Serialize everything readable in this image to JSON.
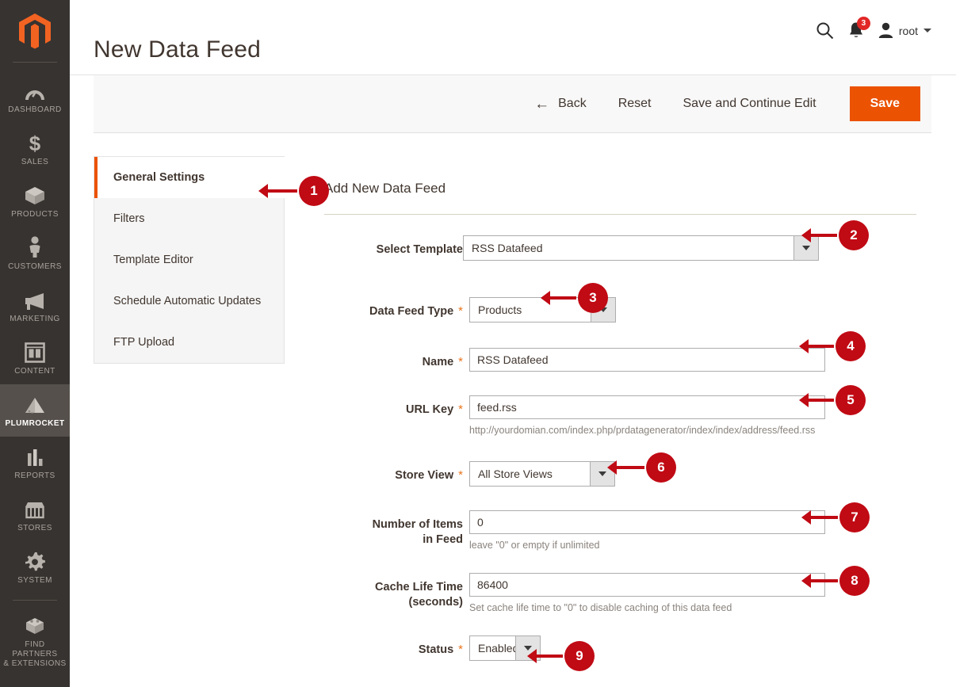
{
  "adminnav": {
    "logo_name": "magento-logo-icon",
    "items": [
      {
        "label": "DASHBOARD",
        "icon": "dashboard-icon",
        "active": false
      },
      {
        "label": "SALES",
        "icon": "dollar-icon",
        "active": false
      },
      {
        "label": "PRODUCTS",
        "icon": "box-icon",
        "active": false
      },
      {
        "label": "CUSTOMERS",
        "icon": "person-icon",
        "active": false
      },
      {
        "label": "MARKETING",
        "icon": "megaphone-icon",
        "active": false
      },
      {
        "label": "CONTENT",
        "icon": "layout-icon",
        "active": false
      },
      {
        "label": "PLUMROCKET",
        "icon": "plumrocket-icon",
        "active": true
      },
      {
        "label": "REPORTS",
        "icon": "bar-chart-icon",
        "active": false
      },
      {
        "label": "STORES",
        "icon": "storefront-icon",
        "active": false
      },
      {
        "label": "SYSTEM",
        "icon": "gear-icon",
        "active": false
      },
      {
        "label": "FIND PARTNERS\n& EXTENSIONS",
        "icon": "extension-box-icon",
        "active": false
      }
    ],
    "find_partners_line1": "FIND PARTNERS",
    "find_partners_line2": "& EXTENSIONS"
  },
  "header": {
    "title": "New Data Feed",
    "search_icon": "search-icon",
    "notifications_icon": "bell-icon",
    "notifications_count": "3",
    "user_icon": "user-avatar-icon",
    "user_name": "root"
  },
  "toolbar": {
    "back_label": "Back",
    "back_arrow": "←",
    "reset_label": "Reset",
    "save_continue_label": "Save and Continue Edit",
    "save_label": "Save",
    "save_color": "#eb5202"
  },
  "tabs": [
    {
      "label": "General Settings",
      "active": true
    },
    {
      "label": "Filters",
      "active": false
    },
    {
      "label": "Template Editor",
      "active": false
    },
    {
      "label": "Schedule Automatic Updates",
      "active": false
    },
    {
      "label": "FTP Upload",
      "active": false
    }
  ],
  "form": {
    "legend": "Add New Data Feed",
    "required_mark": "*",
    "fields": {
      "select_template": {
        "label": "Select Template",
        "value": "RSS Datafeed",
        "required": false
      },
      "data_feed_type": {
        "label": "Data Feed Type",
        "value": "Products",
        "required": true
      },
      "name": {
        "label": "Name",
        "value": "RSS Datafeed",
        "required": true
      },
      "url_key": {
        "label": "URL Key",
        "value": "feed.rss",
        "required": true,
        "hint": "http://yourdomian.com/index.php/prdatagenerator/index/index/address/feed.rss"
      },
      "store_view": {
        "label": "Store View",
        "value": "All Store Views",
        "required": true
      },
      "number_of_items": {
        "label_line1": "Number of Items",
        "label_line2": "in Feed",
        "value": "0",
        "required": false,
        "hint": "leave \"0\" or empty if unlimited"
      },
      "cache_life_time": {
        "label_line1": "Cache Life Time",
        "label_line2": "(seconds)",
        "value": "86400",
        "required": false,
        "hint": "Set cache life time to \"0\" to disable caching of this data feed"
      },
      "status": {
        "label": "Status",
        "value": "Enabled",
        "required": true
      }
    }
  },
  "annotations": {
    "accent_color": "#c00a14",
    "markers": [
      {
        "number": "1",
        "target": "tab-general-settings"
      },
      {
        "number": "2",
        "target": "select-template-field"
      },
      {
        "number": "3",
        "target": "data-feed-type-field"
      },
      {
        "number": "4",
        "target": "name-field"
      },
      {
        "number": "5",
        "target": "url-key-field"
      },
      {
        "number": "6",
        "target": "store-view-field"
      },
      {
        "number": "7",
        "target": "number-of-items-field"
      },
      {
        "number": "8",
        "target": "cache-life-time-field"
      },
      {
        "number": "9",
        "target": "status-field"
      }
    ]
  }
}
